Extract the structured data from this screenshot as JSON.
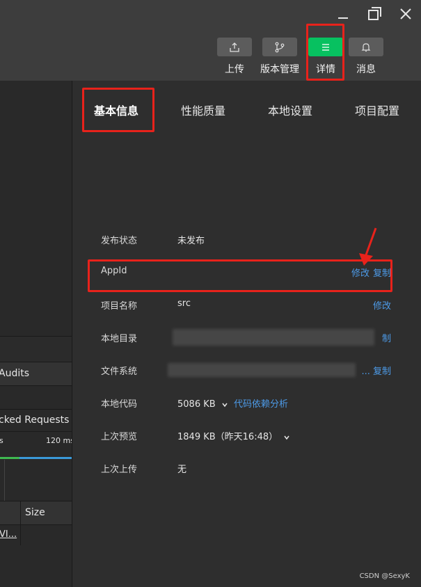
{
  "window_controls": [
    "minimize-icon",
    "maximize-icon",
    "close-icon"
  ],
  "toolbar": {
    "upload_label": "上传",
    "version_label": "版本管理",
    "details_label": "详情",
    "messages_label": "消息",
    "active_color": "#07c160"
  },
  "devtools": {
    "audits_tab": "Audits",
    "blocked_requests": "cked Requests",
    "timeline_left": "s",
    "timeline_right": "120 ms",
    "size_header": "Size",
    "first_cell": "VI..."
  },
  "tabs": [
    {
      "label": "基本信息",
      "active": true
    },
    {
      "label": "性能质量",
      "active": false
    },
    {
      "label": "本地设置",
      "active": false
    },
    {
      "label": "项目配置",
      "active": false
    }
  ],
  "info": {
    "publish_status": {
      "label": "发布状态",
      "value": "未发布"
    },
    "appid": {
      "label": "AppId",
      "edit": "修改",
      "copy": "复制"
    },
    "project_name": {
      "label": "项目名称",
      "value": "src",
      "edit": "修改"
    },
    "local_dir": {
      "label": "本地目录",
      "copy_partial": "制"
    },
    "file_system": {
      "label": "文件系统",
      "suffix": "... 复制"
    },
    "local_code": {
      "label": "本地代码",
      "value": "5086 KB",
      "link": "代码依赖分析"
    },
    "last_preview": {
      "label": "上次预览",
      "value": "1849 KB（昨天16:48）"
    },
    "last_upload": {
      "label": "上次上传",
      "value": "无"
    }
  },
  "watermark": "CSDN @SexyK",
  "colors": {
    "link": "#4d9be8",
    "annotation": "#e8221b"
  }
}
